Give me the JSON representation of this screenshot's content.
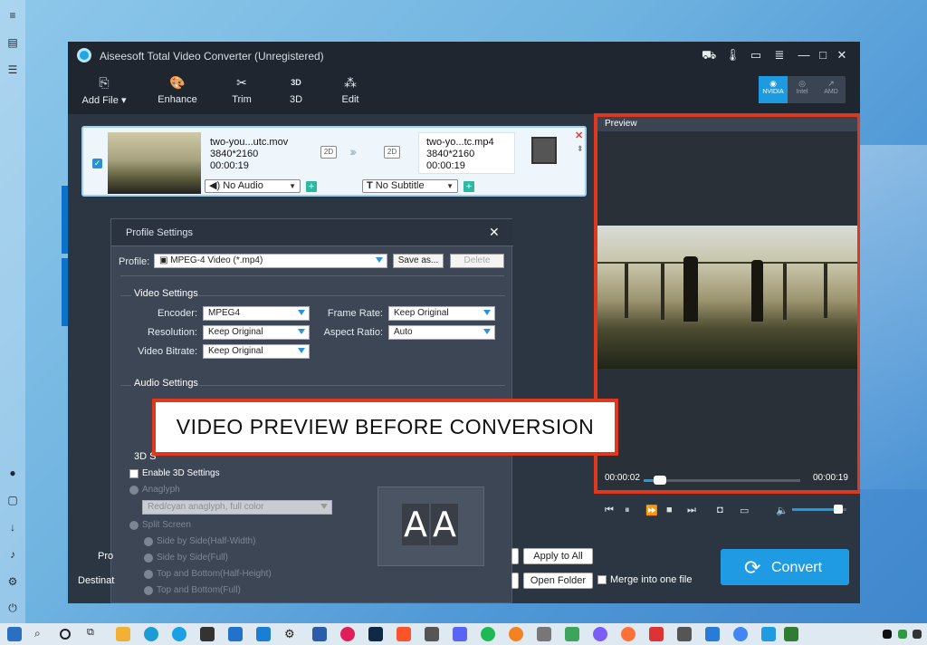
{
  "app": {
    "title": "Aiseesoft Total Video Converter (Unregistered)",
    "toolbar": [
      "Add File",
      "Enhance",
      "Trim",
      "3D",
      "Edit"
    ],
    "gpu": [
      {
        "label": "NVIDIA",
        "active": true
      },
      {
        "label": "Intel",
        "active": false
      },
      {
        "label": "AMD",
        "active": false
      }
    ]
  },
  "file": {
    "source_name": "two-you...utc.mov",
    "source_res": "3840*2160",
    "source_dur": "00:00:19",
    "source_mode": "2D",
    "target_mode": "2D",
    "target_name": "two-yo...tc.mp4",
    "target_res": "3840*2160",
    "target_dur": "00:00:19",
    "audio": "No Audio",
    "subtitle": "No Subtitle"
  },
  "profile_settings": {
    "title": "Profile Settings",
    "profile_label": "Profile:",
    "profile_value": "MPEG-4 Video (*.mp4)",
    "save_as": "Save as...",
    "delete": "Delete",
    "video_section": "Video Settings",
    "encoder_label": "Encoder:",
    "encoder": "MPEG4",
    "frame_rate_label": "Frame Rate:",
    "frame_rate": "Keep Original",
    "resolution_label": "Resolution:",
    "resolution": "Keep Original",
    "aspect_label": "Aspect Ratio:",
    "aspect": "Auto",
    "bitrate_label": "Video Bitrate:",
    "bitrate": "Keep Original",
    "audio_section": "Audio Settings",
    "three_d_section": "3D S",
    "enable_3d": "Enable 3D Settings",
    "anaglyph": "Anaglyph",
    "anaglyph_value": "Red/cyan anaglyph, full color",
    "split_screen": "Split Screen",
    "split_options": [
      "Side by Side(Half-Width)",
      "Side by Side(Full)",
      "Top and Bottom(Half-Height)",
      "Top and Bottom(Full)"
    ],
    "preview_text": "AA"
  },
  "bottom": {
    "profile_short": "Pro",
    "dest_short": "Destinat",
    "apply_all": "Apply to All",
    "open_folder": "Open Folder",
    "merge": "Merge into one file",
    "convert": "Convert"
  },
  "preview": {
    "label": "Preview",
    "time_current": "00:00:02",
    "time_total": "00:00:19",
    "progress_fraction": 0.105,
    "volume_fraction": 0.85
  },
  "overlay": {
    "caption": "VIDEO PREVIEW BEFORE CONVERSION"
  }
}
